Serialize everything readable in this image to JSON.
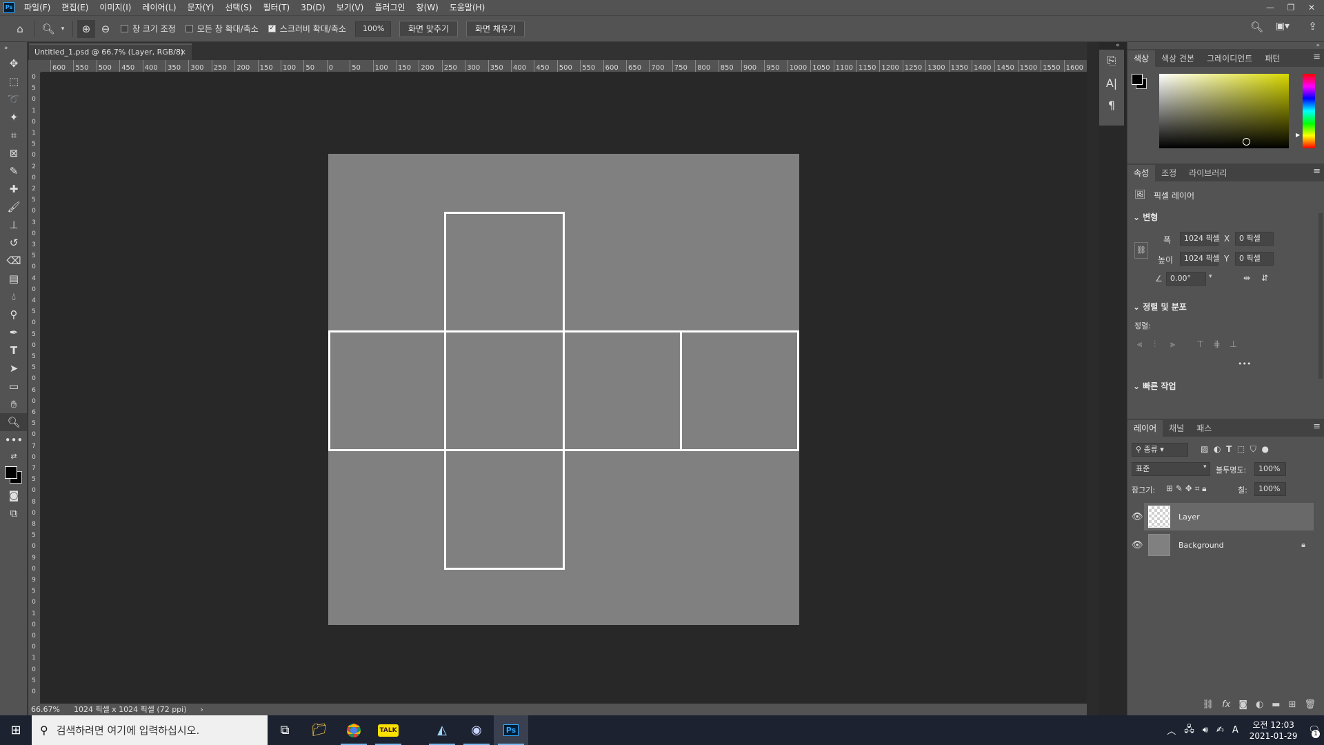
{
  "menubar": {
    "logo": "Ps",
    "items": [
      "파일(F)",
      "편집(E)",
      "이미지(I)",
      "레이어(L)",
      "문자(Y)",
      "선택(S)",
      "필터(T)",
      "3D(D)",
      "보기(V)",
      "플러그인",
      "창(W)",
      "도움말(H)"
    ]
  },
  "options": {
    "resize_windows": "창 크기 조정",
    "zoom_all": "모든 창 확대/축소",
    "scrubby_zoom": "스크러비 확대/축소",
    "zoom_value": "100%",
    "fit_screen": "화면 맞추기",
    "fill_screen": "화면 채우기"
  },
  "document": {
    "tab_title": "Untitled_1.psd @ 66.7% (Layer, RGB/8)"
  },
  "rulers": {
    "horizontal": [
      "600",
      "550",
      "500",
      "450",
      "400",
      "350",
      "300",
      "250",
      "200",
      "150",
      "100",
      "50",
      "0",
      "50",
      "100",
      "150",
      "200",
      "250",
      "300",
      "350",
      "400",
      "450",
      "500",
      "550",
      "600",
      "650",
      "700",
      "750",
      "800",
      "850",
      "900",
      "950",
      "1000",
      "1050",
      "1100",
      "1150",
      "1200",
      "1250",
      "1300",
      "1350",
      "1400",
      "1450",
      "1500",
      "1550",
      "1600"
    ],
    "vertical": [
      "0",
      "5",
      "0",
      "1",
      "0",
      "1",
      "5",
      "0",
      "2",
      "0",
      "2",
      "5",
      "0",
      "3",
      "0",
      "3",
      "5",
      "0",
      "4",
      "0",
      "4",
      "5",
      "0",
      "5",
      "0",
      "5",
      "5",
      "0",
      "6",
      "0",
      "6",
      "5",
      "0",
      "7",
      "0",
      "7",
      "5",
      "0",
      "8",
      "0",
      "8",
      "5",
      "0",
      "9",
      "0",
      "9",
      "5",
      "0",
      "1",
      "0",
      "0",
      "0",
      "1",
      "0",
      "5",
      "0"
    ]
  },
  "status": {
    "zoom": "66.67%",
    "info": "1024 픽셀 x 1024 픽셀 (72 ppi)"
  },
  "color_panel": {
    "tabs": [
      "색상",
      "색상 견본",
      "그레이디언트",
      "패턴"
    ]
  },
  "properties_panel": {
    "tabs": [
      "속성",
      "조정",
      "라이브러리"
    ],
    "type_label": "픽셀 레이어",
    "transform_section": "변형",
    "width_label": "폭",
    "width_value": "1024 픽셀",
    "height_label": "높이",
    "height_value": "1024 픽셀",
    "x_label": "X",
    "x_value": "0 픽셀",
    "y_label": "Y",
    "y_value": "0 픽셀",
    "angle_value": "0.00°",
    "align_section": "정렬 및 분포",
    "align_label": "정렬:",
    "quick_section": "빠른 작업"
  },
  "layers_panel": {
    "tabs": [
      "레이어",
      "채널",
      "패스"
    ],
    "filter_label": "종류",
    "blend_mode": "표준",
    "opacity_label": "불투명도:",
    "opacity_value": "100%",
    "lock_label": "잠그기:",
    "fill_label": "칠:",
    "fill_value": "100%",
    "layers": [
      {
        "name": "Layer",
        "selected": true
      },
      {
        "name": "Background",
        "selected": false
      }
    ]
  },
  "taskbar": {
    "search_placeholder": "검색하려면 여기에 입력하십시오.",
    "time": "오전 12:03",
    "date": "2021-01-29",
    "ime": "A",
    "kakao_label": "TALK",
    "ps_label": "Ps",
    "notification_count": "1"
  },
  "colors": {
    "canvas": "#808080",
    "workspace": "#282828",
    "panel": "#535353",
    "net_lines": "#ffffff"
  }
}
